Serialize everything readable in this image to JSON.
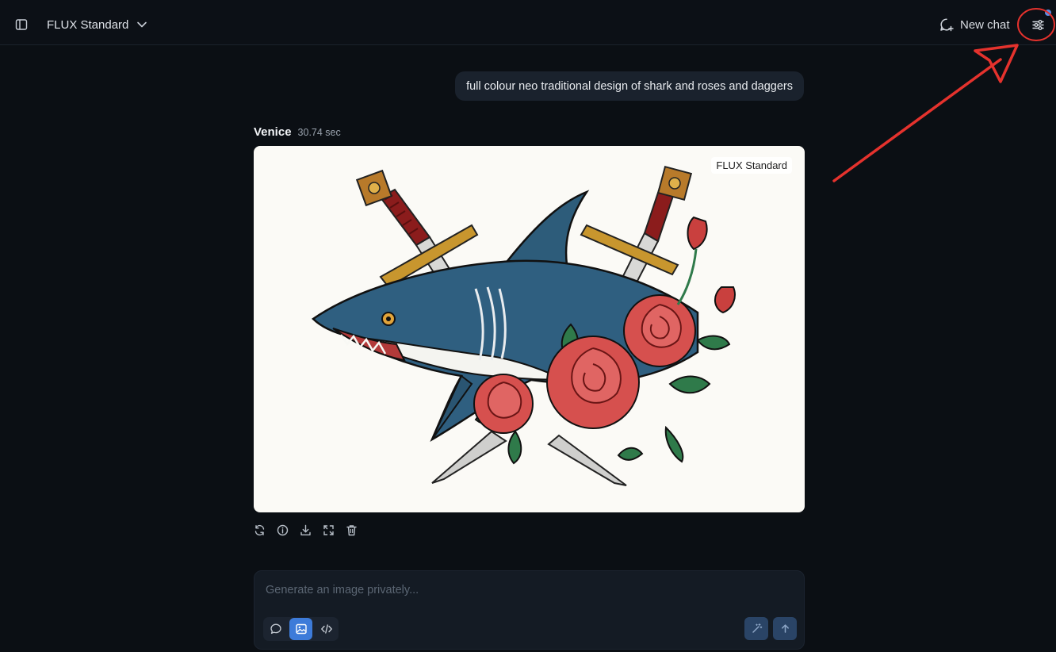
{
  "header": {
    "model_name": "FLUX Standard",
    "new_chat_label": "New chat"
  },
  "conversation": {
    "user_prompt": "full colour neo traditional design of shark and roses and daggers",
    "assistant_name": "Venice",
    "response_time": "30.74 sec",
    "image_model_badge": "FLUX Standard"
  },
  "image_actions": [
    "refresh-icon",
    "info-icon",
    "download-icon",
    "expand-icon",
    "trash-icon"
  ],
  "composer": {
    "placeholder": "Generate an image privately...",
    "value": "",
    "modes": [
      "chat-icon",
      "image-icon",
      "code-icon"
    ],
    "active_mode": "image"
  },
  "colors": {
    "background": "#0b0f14",
    "accent": "#3d7bd9",
    "annotation": "#e5322d"
  }
}
